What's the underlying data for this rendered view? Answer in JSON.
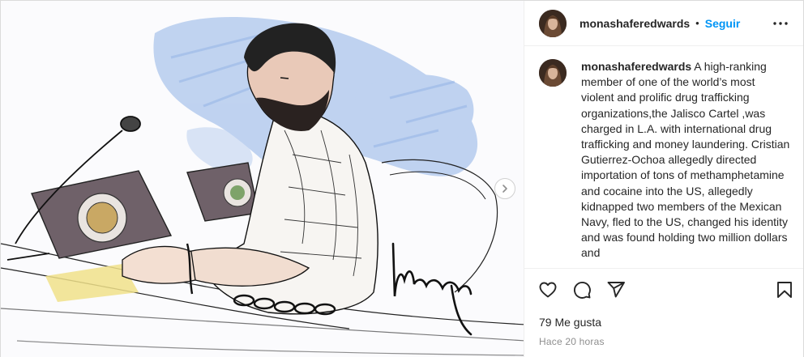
{
  "post": {
    "username": "monashaferedwards",
    "separator": "•",
    "follow_label": "Seguir",
    "more_icon": "more-horizontal-icon",
    "caption_user": "monashaferedwards",
    "caption_text": "A high-ranking member of one of the world’s most violent and prolific drug trafficking organizations,the Jalisco Cartel ,was charged in L.A. with international drug trafficking and money laundering. Cristian Gutierrez-Ochoa allegedly directed importation of tons of methamphetamine and cocaine into the US, allegedly kidnapped two members of the Mexican Navy, fled to the US, changed his identity and was found holding two million dollars and",
    "likes_text": "79 Me gusta",
    "time_text": "Hace 20 horas"
  },
  "icons": {
    "like": "heart-icon",
    "comment": "comment-icon",
    "share": "send-icon",
    "save": "bookmark-icon",
    "next": "chevron-right-icon"
  },
  "image": {
    "signature_text": "Mona"
  },
  "colors": {
    "link_blue": "#0095f6",
    "text": "#262626",
    "secondary": "#8e8e8e",
    "border": "#efefef"
  }
}
